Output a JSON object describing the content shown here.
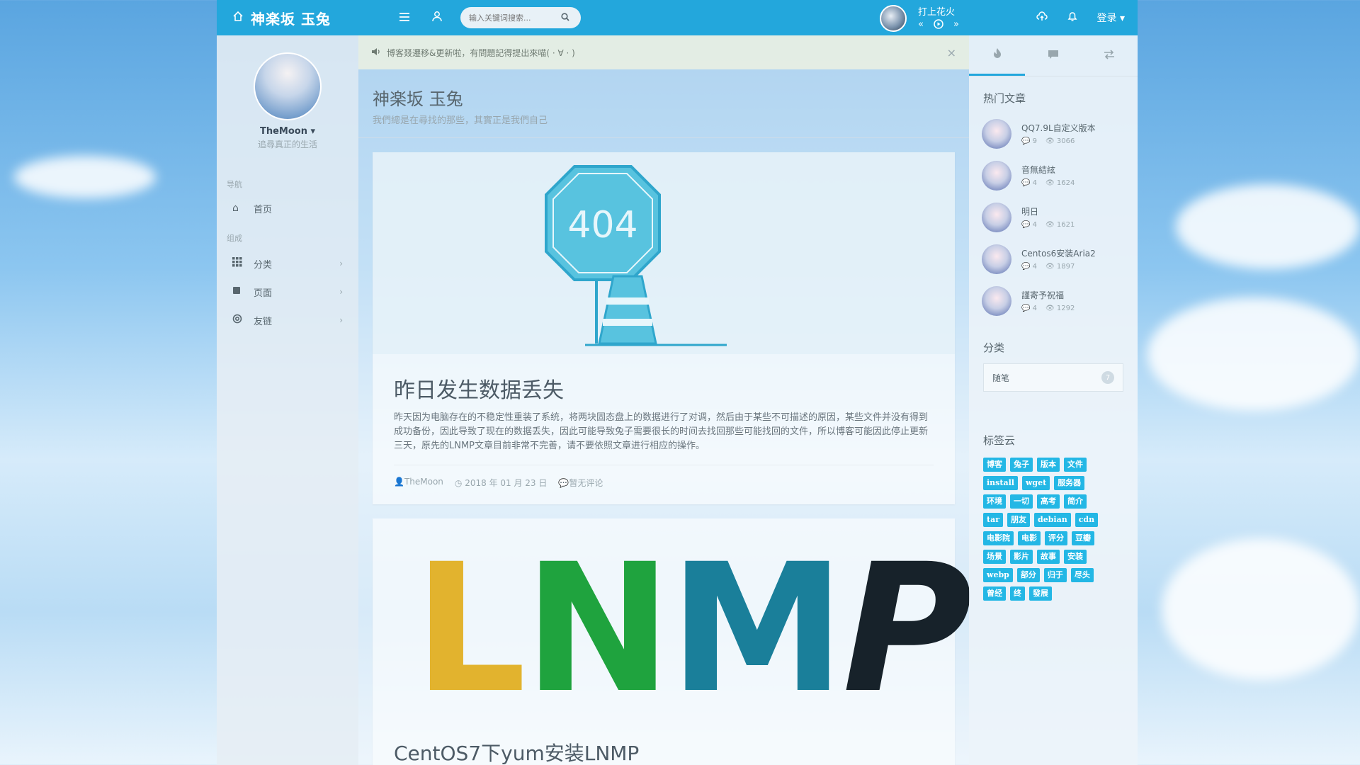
{
  "header": {
    "brand_title": "神楽坂 玉兔",
    "search_placeholder": "输入关键词搜索...",
    "player_title": "打上花火",
    "login_label": "登录"
  },
  "notice": {
    "text": "博客叕遷移&更新啦，有問題記得提出來喵( · ∀ · )"
  },
  "aside": {
    "user_name": "TheMoon",
    "user_motto": "追尋真正的生活",
    "nav_head": "导航",
    "home_label": "首页",
    "group_head": "组成",
    "items": [
      {
        "label": "分类"
      },
      {
        "label": "页面"
      },
      {
        "label": "友链"
      }
    ]
  },
  "page": {
    "title": "神楽坂 玉兔",
    "subtitle": "我們總是在尋找的那些，其實正是我們自己"
  },
  "posts": [
    {
      "thumb_text": "404",
      "title": "昨日发生数据丢失",
      "excerpt": "昨天因为电脑存在的不稳定性重装了系统，将两块固态盘上的数据进行了对调，然后由于某些不可描述的原因，某些文件并没有得到成功备份，因此导致了现在的数据丢失，因此可能导致兔子需要很长的时间去找回那些可能找回的文件，所以博客可能因此停止更新三天，原先的LNMP文章目前非常不完善，请不要依照文章进行相应的操作。",
      "author": "TheMoon",
      "date": "2018 年 01 月 23 日",
      "comments": "暂无评论"
    },
    {
      "thumb_letters": [
        "L",
        "N",
        "M",
        "P"
      ],
      "title": "CentOS7下yum安装LNMP"
    }
  ],
  "right": {
    "hot_title": "热门文章",
    "hot": [
      {
        "title": "QQ7.9L自定义版本",
        "comments": "9",
        "views": "3066"
      },
      {
        "title": "音無結絃",
        "comments": "4",
        "views": "1624"
      },
      {
        "title": "明日",
        "comments": "4",
        "views": "1621"
      },
      {
        "title": "Centos6安装Aria2",
        "comments": "4",
        "views": "1897"
      },
      {
        "title": "謹寄予祝福",
        "comments": "4",
        "views": "1292"
      }
    ],
    "category_title": "分类",
    "category": {
      "name": "随笔",
      "count": "7"
    },
    "tags_title": "标签云",
    "tags": [
      "博客",
      "兔子",
      "版本",
      "文件",
      "install",
      "wget",
      "服务器",
      "环境",
      "一切",
      "高考",
      "简介",
      "tar",
      "朋友",
      "debian",
      "cdn",
      "电影院",
      "电影",
      "评分",
      "豆瓣",
      "场景",
      "影片",
      "故事",
      "安装",
      "webp",
      "部分",
      "归于",
      "尽头",
      "曾经",
      "终",
      "發展"
    ]
  },
  "colors": {
    "accent": "#23a7dc",
    "tag_bg": "#23b7e5"
  }
}
